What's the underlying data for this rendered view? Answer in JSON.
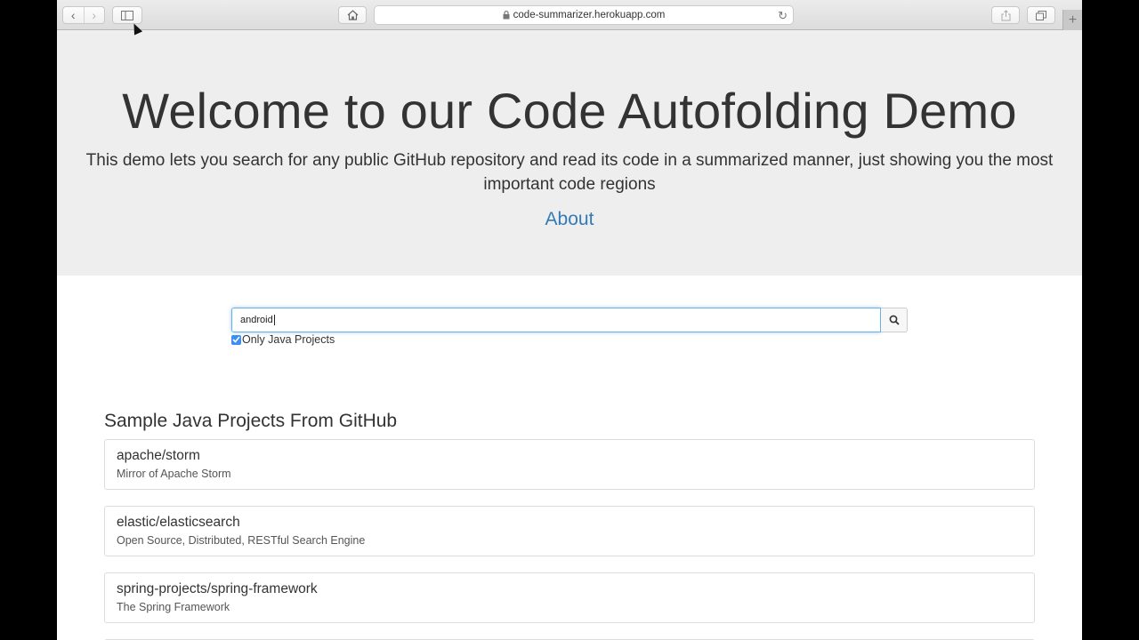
{
  "browser": {
    "url": "code-summarizer.herokuapp.com"
  },
  "hero": {
    "title": "Welcome to our Code Autofolding Demo",
    "lead": "This demo lets you search for any public GitHub repository and read its code in a summarized manner, just showing you the most important code regions",
    "about_link": "About"
  },
  "search": {
    "value": "android",
    "checkbox_label": "Only Java Projects",
    "checkbox_checked": true
  },
  "samples": {
    "heading": "Sample Java Projects From GitHub",
    "items": [
      {
        "name": "apache/storm",
        "description": "Mirror of Apache Storm"
      },
      {
        "name": "elastic/elasticsearch",
        "description": "Open Source, Distributed, RESTful Search Engine"
      },
      {
        "name": "spring-projects/spring-framework",
        "description": "The Spring Framework"
      }
    ]
  }
}
